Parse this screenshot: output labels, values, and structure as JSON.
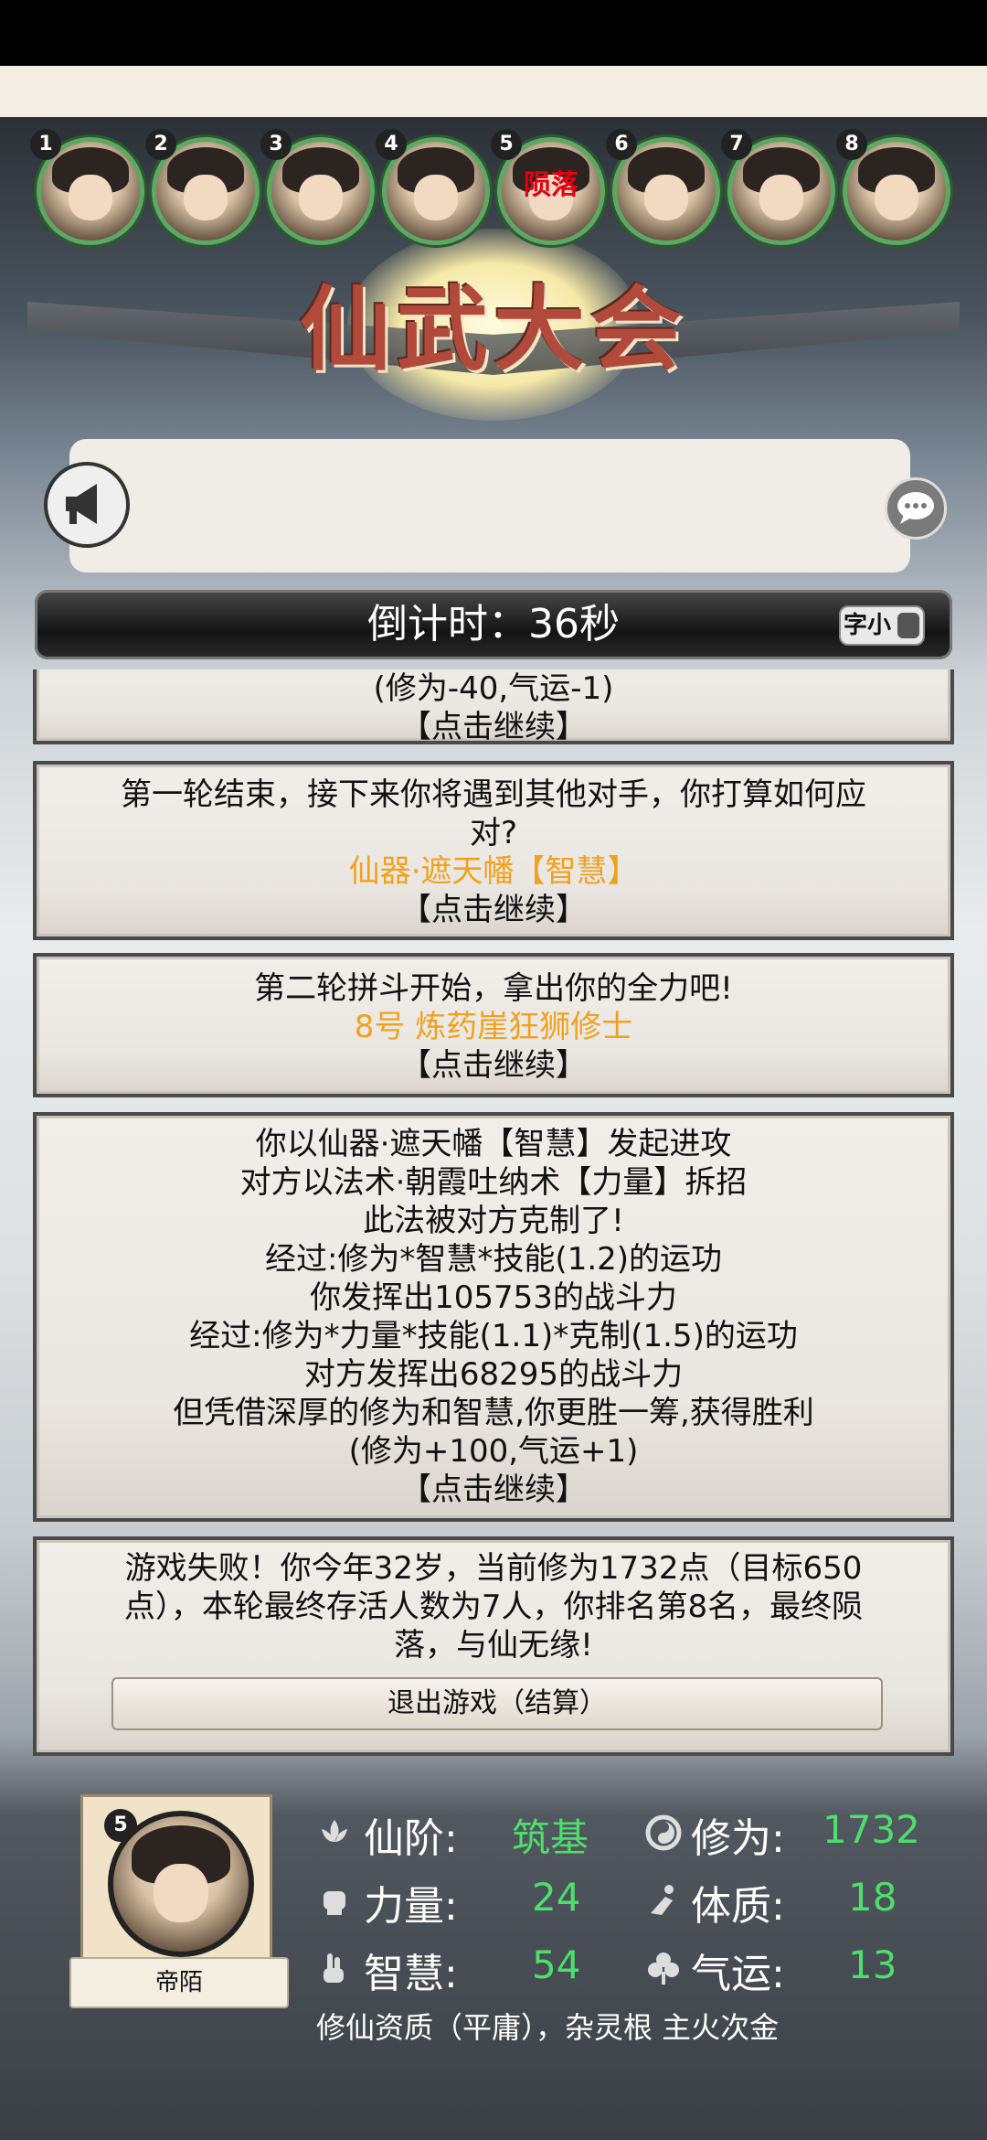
{
  "avatars": [
    {
      "num": "1",
      "status": ""
    },
    {
      "num": "2",
      "status": ""
    },
    {
      "num": "3",
      "status": ""
    },
    {
      "num": "4",
      "status": ""
    },
    {
      "num": "5",
      "status": "陨落"
    },
    {
      "num": "6",
      "status": ""
    },
    {
      "num": "7",
      "status": ""
    },
    {
      "num": "8",
      "status": ""
    }
  ],
  "game_title": "仙武大会",
  "timer": {
    "label": "倒计时：36秒",
    "font_toggle_label": "字小"
  },
  "log": [
    {
      "lines": [
        "(修为-40,气运-1)"
      ],
      "continue": "【点击继续】"
    },
    {
      "lines": [
        "第一轮结束，接下来你将遇到其他对手，你打算如何应",
        "对?"
      ],
      "highlight": "仙器·遮天幡【智慧】",
      "continue": "【点击继续】"
    },
    {
      "lines": [
        "第二轮拼斗开始，拿出你的全力吧!"
      ],
      "highlight": "8号 炼药崖狂狮修士",
      "continue": "【点击继续】"
    },
    {
      "lines": [
        "你以仙器·遮天幡【智慧】发起进攻",
        "对方以法术·朝霞吐纳术【力量】拆招",
        "此法被对方克制了!",
        "经过:修为*智慧*技能(1.2)的运功",
        "你发挥出105753的战斗力",
        "经过:修为*力量*技能(1.1)*克制(1.5)的运功",
        "对方发挥出68295的战斗力",
        "但凭借深厚的修为和智慧,你更胜一筹,获得胜利",
        "(修为+100,气运+1)"
      ],
      "continue": "【点击继续】"
    },
    {
      "lines": [
        "游戏失败！你今年32岁，当前修为1732点（目标650",
        "点），本轮最终存活人数为7人，你排名第8名，最终陨",
        "落，与仙无缘!"
      ],
      "button": "退出游戏（结算）"
    }
  ],
  "player": {
    "num": "5",
    "name": "帝陌",
    "stats": [
      {
        "icon": "lotus-icon",
        "label": "仙阶:",
        "value": "筑基"
      },
      {
        "icon": "swirl-icon",
        "label": "修为:",
        "value": "1732"
      },
      {
        "icon": "fist-icon",
        "label": "力量:",
        "value": "24"
      },
      {
        "icon": "body-icon",
        "label": "体质:",
        "value": "18"
      },
      {
        "icon": "hand-sign-icon",
        "label": "智慧:",
        "value": "54"
      },
      {
        "icon": "clover-icon",
        "label": "气运:",
        "value": "13"
      }
    ],
    "talent": "修仙资质（平庸），杂灵根 主火次金"
  },
  "colors": {
    "accent_green": "#4ede6c",
    "highlight_orange": "#f0a21f",
    "dead_red": "#e10010"
  }
}
